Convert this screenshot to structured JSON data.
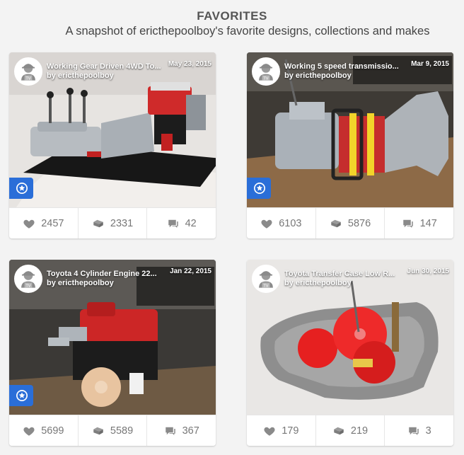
{
  "header": {
    "title": "FAVORITES",
    "subtitle": "A snapshot of ericthepoolboy's favorite designs, collections and makes"
  },
  "cards": [
    {
      "title": "Working Gear Driven 4WD To...",
      "by": "by ericthepoolboy",
      "date": "May 23, 2015",
      "featured": true,
      "likes": "2457",
      "collects": "2331",
      "comments": "42"
    },
    {
      "title": "Working 5 speed transmissio...",
      "by": "by ericthepoolboy",
      "date": "Mar 9, 2015",
      "featured": true,
      "likes": "6103",
      "collects": "5876",
      "comments": "147"
    },
    {
      "title": "Toyota 4 Cylinder Engine 22...",
      "by": "by ericthepoolboy",
      "date": "Jan 22, 2015",
      "featured": true,
      "likes": "5699",
      "collects": "5589",
      "comments": "367"
    },
    {
      "title": "Toyota Transfer Case Low R...",
      "by": "by ericthepoolboy",
      "date": "Jun 30, 2015",
      "featured": false,
      "likes": "179",
      "collects": "219",
      "comments": "3"
    }
  ],
  "icons": {
    "like": "heart-icon",
    "collect": "layers-icon",
    "comment": "comment-icon",
    "featured": "star-badge-icon"
  },
  "colors": {
    "featured_badge": "#2a6ed8",
    "stat_text": "#777777",
    "engine_red": "#d8262b"
  }
}
